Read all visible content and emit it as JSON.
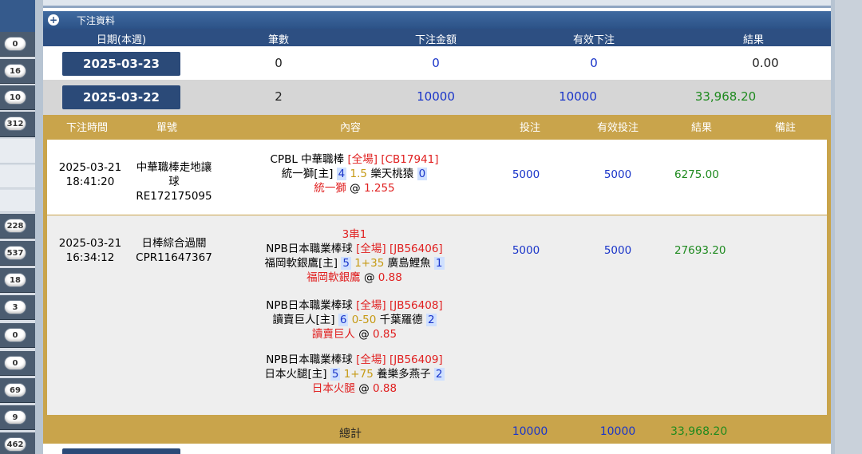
{
  "rail": {
    "badges": [
      "0",
      "16",
      "10",
      "312",
      "228",
      "537",
      "18",
      "3",
      "0",
      "0",
      "69",
      "9",
      "462"
    ]
  },
  "section": {
    "title": "下注資料"
  },
  "columns": {
    "date": "日期(本週)",
    "count": "筆數",
    "amount": "下注金額",
    "valid": "有效下注",
    "result": "結果"
  },
  "days": [
    {
      "date": "2025-03-23",
      "count": "0",
      "amount": "0",
      "valid": "0",
      "result": "0.00"
    },
    {
      "date": "2025-03-22",
      "count": "2",
      "amount": "10000",
      "valid": "10000",
      "result": "33,968.20"
    }
  ],
  "detail_columns": {
    "time": "下注時間",
    "no": "單號",
    "content": "內容",
    "bet": "投注",
    "valid": "有效投注",
    "result": "結果",
    "note": "備註"
  },
  "bets": [
    {
      "date": "2025-03-21",
      "time": "18:41:20",
      "type_line1": "中華職棒走地讓",
      "type_line2": "球",
      "no": "RE172175095",
      "legs": [
        {
          "league": "CPBL 中華職棒",
          "scope": "[全場]",
          "code": "[CB17941]",
          "home": "統一獅[主]",
          "home_score": "4",
          "line": "1.5",
          "away": "樂天桃猿",
          "away_score": "0",
          "pick": "統一獅",
          "at": "@",
          "odds": "1.255"
        }
      ],
      "bet": "5000",
      "valid": "5000",
      "result": "6275.00"
    },
    {
      "date": "2025-03-21",
      "time": "16:34:12",
      "type_line1": "日棒綜合過關",
      "no": "CPR11647367",
      "parlay": "3串1",
      "legs": [
        {
          "league": "NPB日本職業棒球",
          "scope": "[全場]",
          "code": "[JB56406]",
          "home": "福岡軟銀鷹[主]",
          "home_score": "5",
          "line": "1+35",
          "away": "廣島鯉魚",
          "away_score": "1",
          "pick": "福岡軟銀鷹",
          "at": "@",
          "odds": "0.88"
        },
        {
          "league": "NPB日本職業棒球",
          "scope": "[全場]",
          "code": "[JB56408]",
          "home": "讀賣巨人[主]",
          "home_score": "6",
          "line": "0-50",
          "away": "千葉羅德",
          "away_score": "2",
          "pick": "讀賣巨人",
          "at": "@",
          "odds": "0.85"
        },
        {
          "league": "NPB日本職業棒球",
          "scope": "[全場]",
          "code": "[JB56409]",
          "home": "日本火腿[主]",
          "home_score": "5",
          "line": "1+75",
          "away": "養樂多燕子",
          "away_score": "2",
          "pick": "日本火腿",
          "at": "@",
          "odds": "0.88"
        }
      ],
      "bet": "5000",
      "valid": "5000",
      "result": "27693.20"
    }
  ],
  "total": {
    "label": "總計",
    "bet": "10000",
    "valid": "10000",
    "result": "33,968.20"
  },
  "colors": {
    "navy": "#2b4a78",
    "gold_bar": "#c9a44b",
    "blue_value": "#1a35c9",
    "green_value": "#1f8a1f",
    "red_pick": "#e02020"
  }
}
